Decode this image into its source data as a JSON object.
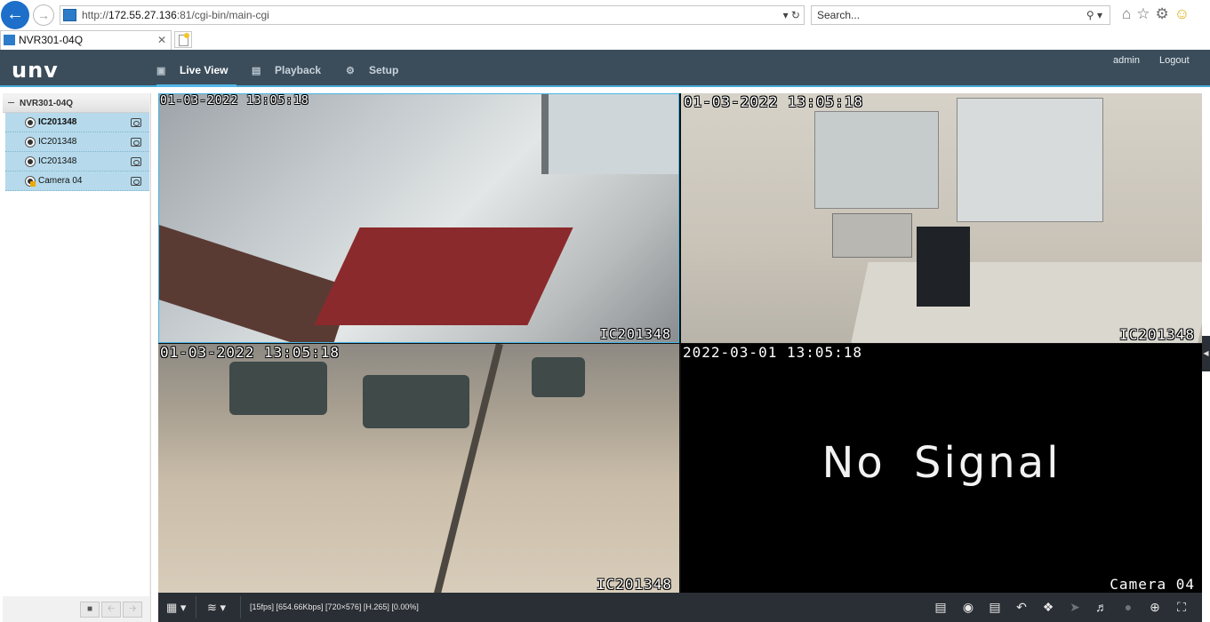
{
  "browser": {
    "url_prefix": "http://",
    "url_host": "172.55.27.136",
    "url_rest": ":81/cgi-bin/main-cgi",
    "search_placeholder": "Search...",
    "tab_title": "NVR301-04Q"
  },
  "header": {
    "logo": "unv",
    "nav": [
      {
        "label": "Live View",
        "icon": "monitor-icon",
        "active": true
      },
      {
        "label": "Playback",
        "icon": "film-icon",
        "active": false
      },
      {
        "label": "Setup",
        "icon": "gear-icon",
        "active": false
      }
    ],
    "user": "admin",
    "logout": "Logout"
  },
  "sidebar": {
    "device": "NVR301-04Q",
    "channels": [
      {
        "label": "IC201348"
      },
      {
        "label": "IC201348"
      },
      {
        "label": "IC201348"
      },
      {
        "label": "Camera 04"
      }
    ]
  },
  "views": [
    {
      "timestamp": "01-03-2022 13:05:18",
      "camera": "IC201348"
    },
    {
      "timestamp": "01-03-2022 13:05:18",
      "camera": "IC201348"
    },
    {
      "timestamp": "01-03-2022 13:05:18",
      "camera": "IC201348"
    },
    {
      "timestamp": "2022-03-01 13:05:18",
      "camera": "Camera 04",
      "message": "No Signal"
    }
  ],
  "toolbar": {
    "stream_info": "[15fps] [654.66Kbps] [720×576] [H.265] [0.00%]"
  },
  "colors": {
    "header_bg": "#3b4d5b",
    "accent": "#48a8d6",
    "selected_row": "#b6daeb",
    "toolbar_bg": "#2a2f35"
  }
}
